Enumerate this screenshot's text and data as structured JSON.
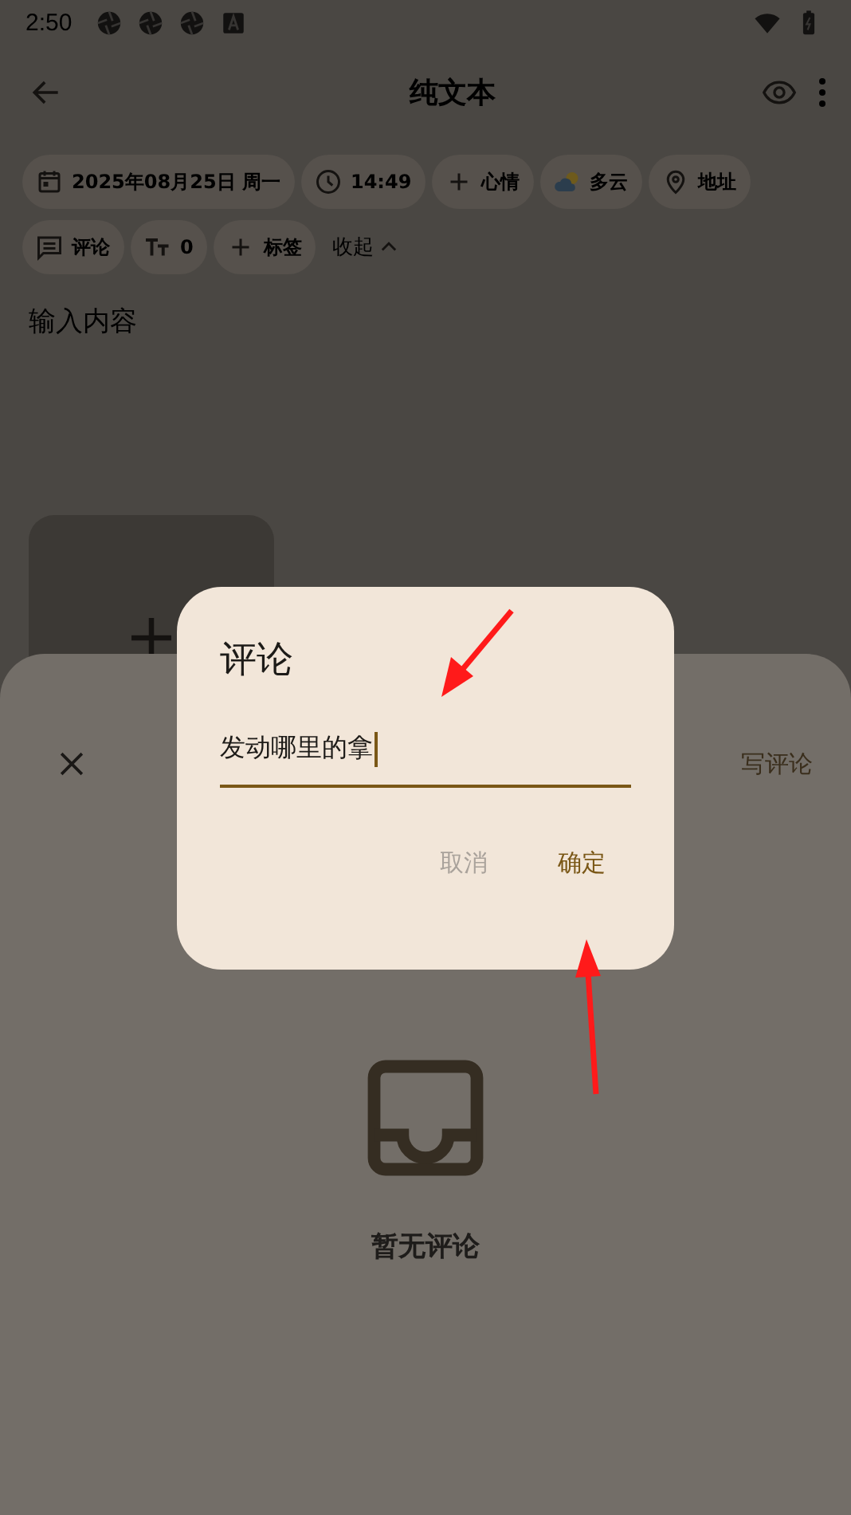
{
  "status_bar": {
    "time": "2:50"
  },
  "app_bar": {
    "title": "纯文本"
  },
  "chips": [
    {
      "kind": "date",
      "label": "2025年08月25日 周一"
    },
    {
      "kind": "time",
      "label": "14:49"
    },
    {
      "kind": "mood",
      "label": "心情"
    },
    {
      "kind": "weather",
      "label": "多云"
    },
    {
      "kind": "address",
      "label": "地址"
    },
    {
      "kind": "comment",
      "label": "评论"
    },
    {
      "kind": "word_count",
      "label": "0"
    },
    {
      "kind": "tag",
      "label": "标签"
    }
  ],
  "collapse": {
    "label": "收起"
  },
  "editor": {
    "placeholder": "输入内容"
  },
  "sheet": {
    "action": "写评论",
    "empty_text": "暂无评论"
  },
  "dialog": {
    "title": "评论",
    "value": "发动哪里的拿",
    "buttons": [
      {
        "label": "取消",
        "disabled": true
      },
      {
        "label": "确定",
        "disabled": false
      }
    ]
  }
}
